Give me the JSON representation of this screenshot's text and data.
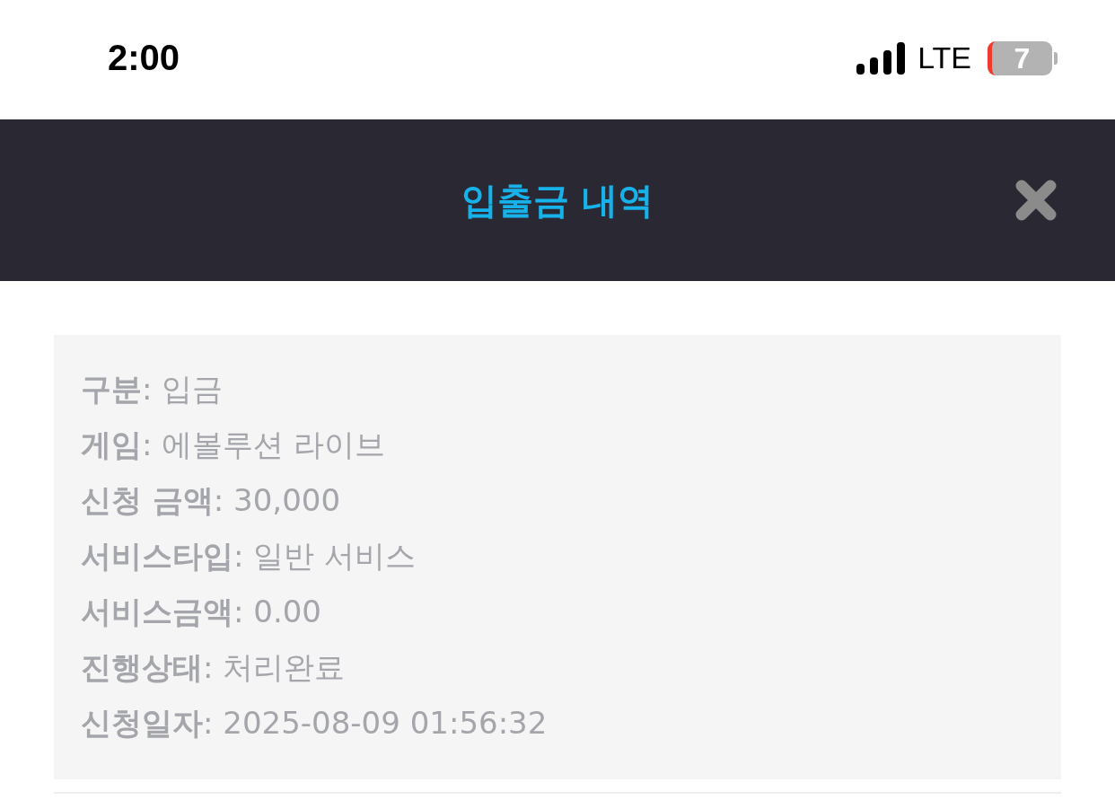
{
  "status_bar": {
    "time": "2:00",
    "network": "LTE",
    "battery": "7"
  },
  "header": {
    "title": "입출금 내역"
  },
  "details": [
    {
      "text": "**구분**: 입금"
    },
    {
      "text": "**게임**: 에볼루션 라이브"
    },
    {
      "text": "**신청 금액**: 30,000"
    },
    {
      "text": "**서비스타입**: 일반 서비스"
    },
    {
      "text": "**서비스금액**: 0.00"
    },
    {
      "text": "**진행상태**: 처리완료"
    },
    {
      "text": "**신청일자**: 2025-08-09 01:56:32"
    }
  ]
}
